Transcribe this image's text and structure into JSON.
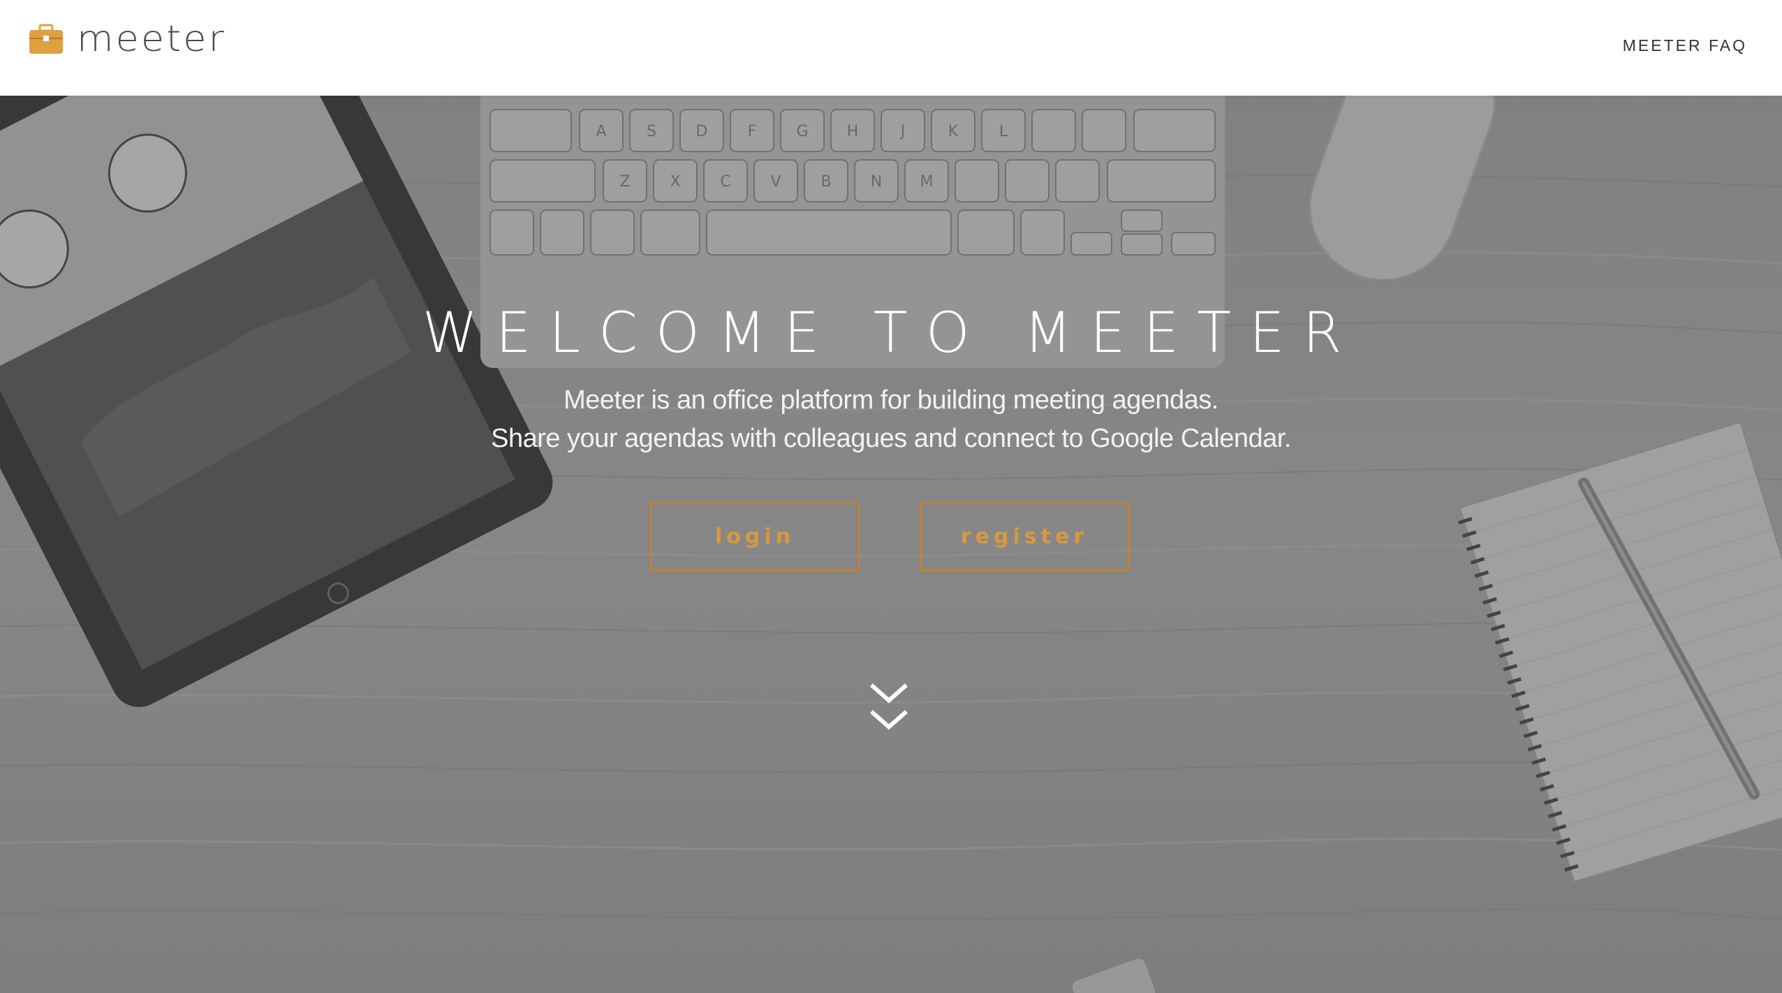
{
  "navbar": {
    "brand_name": "meeter",
    "brand_icon": "briefcase-icon",
    "faq_link": "MEETER FAQ"
  },
  "hero": {
    "title": "WELCOME TO MEETER",
    "subtitle_line1": "Meeter is an office platform for building meeting agendas.",
    "subtitle_line2": "Share your agendas with colleagues and connect to Google Calendar.",
    "login_label": "login",
    "register_label": "register",
    "scroll_icon": "double-chevron-down-icon"
  },
  "colors": {
    "accent": "#c7842a",
    "brand_icon": "#e0a040",
    "nav_text": "#333333",
    "hero_text": "#ffffff"
  }
}
